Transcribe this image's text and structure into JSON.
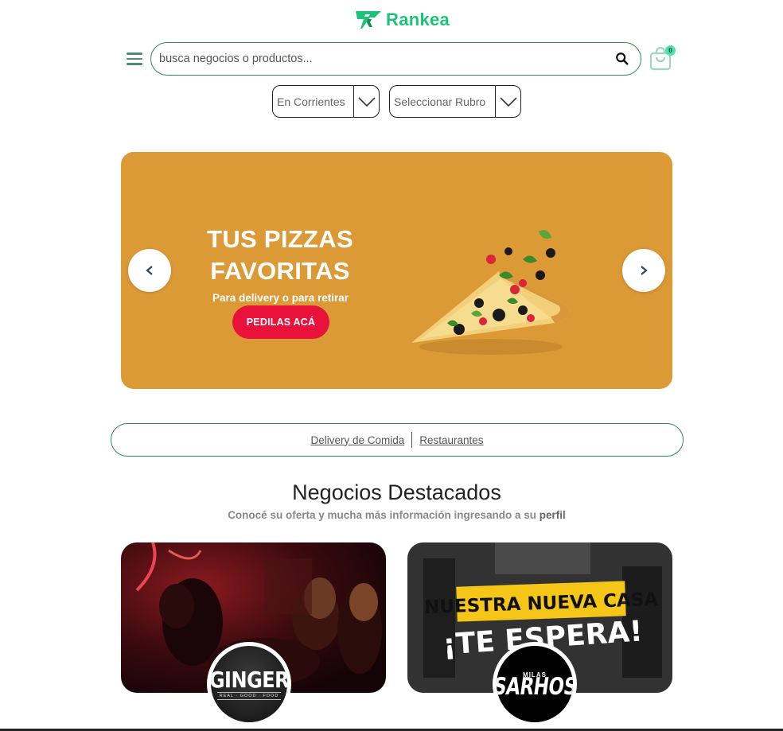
{
  "brand": {
    "name": "Rankea",
    "color": "#1ec37a"
  },
  "header": {
    "search": {
      "placeholder": "busca negocios o productos...",
      "value": ""
    },
    "cart": {
      "count": "0"
    }
  },
  "filters": {
    "city": {
      "selected": "En Corrientes"
    },
    "rubro": {
      "selected": "Seleccionar Rubro"
    }
  },
  "banner": {
    "title_line1": "TUS PIZZAS",
    "title_line2": "FAVORITAS",
    "subtitle": "Para delivery o para retirar",
    "cta": "PEDILAS ACÁ",
    "background": "#dc9a36",
    "cta_color": "#e8123a"
  },
  "categories": [
    {
      "label": "Delivery de Comida "
    },
    {
      "label": "Restaurantes"
    }
  ],
  "featured": {
    "title": "Negocios Destacados",
    "subtitle": "Conocé su oferta y mucha más información ingresando a su ",
    "subtitle_bold": "perfil",
    "businesses": [
      {
        "logo_text": "GINGER",
        "logo_sub": "REAL · GOOD · FOOD"
      },
      {
        "banner_line1": "NUESTRA NUEVA CASA",
        "banner_line2": "¡TE ESPERA!",
        "logo_small": "MILAS",
        "logo_text": "SARHOS"
      }
    ]
  }
}
